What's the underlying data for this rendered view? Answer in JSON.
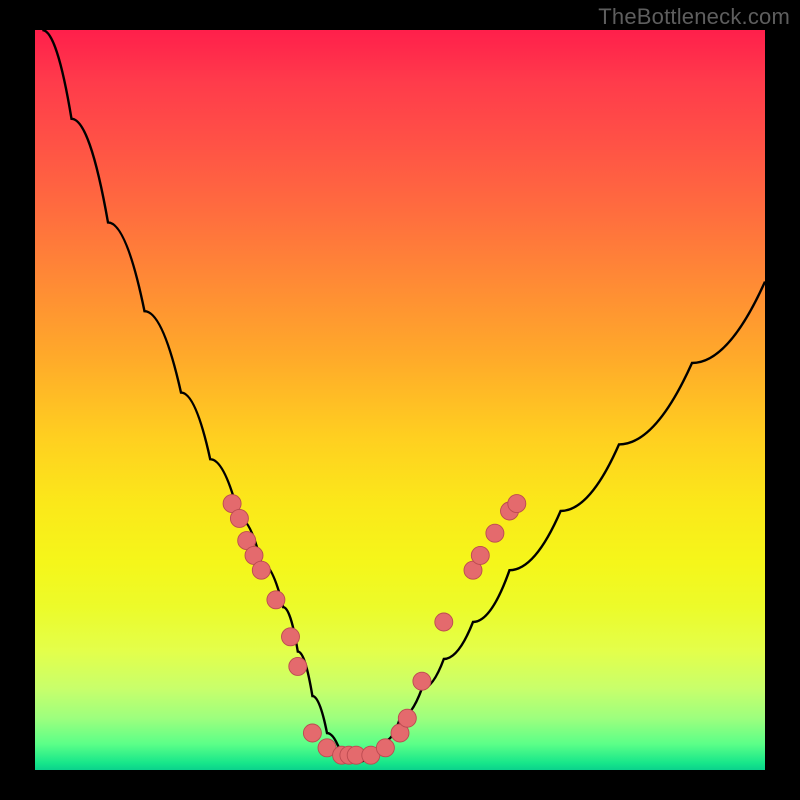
{
  "watermark": "TheBottleneck.com",
  "colors": {
    "bg": "#000000",
    "curve": "#000000",
    "marker_fill": "#e46a6d",
    "marker_stroke": "#bb4a50"
  },
  "chart_data": {
    "type": "line",
    "title": "",
    "xlabel": "",
    "ylabel": "",
    "xlim": [
      0,
      100
    ],
    "ylim": [
      0,
      100
    ],
    "note": "V-shaped bottleneck curve; minimum near x≈44; y represents bottleneck %, lower is better (green).",
    "series": [
      {
        "name": "bottleneck_curve",
        "x": [
          1,
          5,
          10,
          15,
          20,
          24,
          28,
          31,
          34,
          36,
          38,
          40,
          42,
          44,
          46,
          48,
          50,
          53,
          56,
          60,
          65,
          72,
          80,
          90,
          100
        ],
        "y": [
          100,
          88,
          74,
          62,
          51,
          42,
          34,
          28,
          22,
          16,
          10,
          5,
          2,
          1,
          2,
          4,
          7,
          11,
          15,
          20,
          27,
          35,
          44,
          55,
          66
        ]
      }
    ],
    "markers": {
      "name": "sample_points",
      "note": "pink dots along the curve near the valley",
      "points": [
        {
          "x": 27,
          "y": 36
        },
        {
          "x": 28,
          "y": 34
        },
        {
          "x": 29,
          "y": 31
        },
        {
          "x": 30,
          "y": 29
        },
        {
          "x": 31,
          "y": 27
        },
        {
          "x": 33,
          "y": 23
        },
        {
          "x": 35,
          "y": 18
        },
        {
          "x": 36,
          "y": 14
        },
        {
          "x": 38,
          "y": 5
        },
        {
          "x": 40,
          "y": 3
        },
        {
          "x": 42,
          "y": 2
        },
        {
          "x": 43,
          "y": 2
        },
        {
          "x": 44,
          "y": 2
        },
        {
          "x": 46,
          "y": 2
        },
        {
          "x": 48,
          "y": 3
        },
        {
          "x": 50,
          "y": 5
        },
        {
          "x": 51,
          "y": 7
        },
        {
          "x": 53,
          "y": 12
        },
        {
          "x": 56,
          "y": 20
        },
        {
          "x": 60,
          "y": 27
        },
        {
          "x": 61,
          "y": 29
        },
        {
          "x": 63,
          "y": 32
        },
        {
          "x": 65,
          "y": 35
        },
        {
          "x": 66,
          "y": 36
        }
      ]
    }
  }
}
